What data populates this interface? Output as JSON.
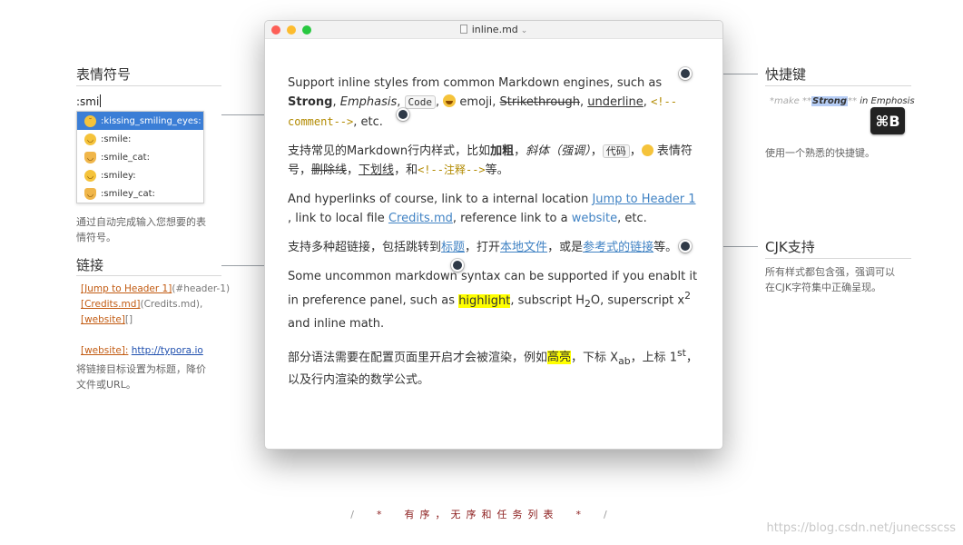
{
  "window": {
    "title": "inline.md"
  },
  "annotations": {
    "emoji": {
      "title": "表情符号",
      "typed": ":smi",
      "suggestions": [
        {
          "icon": "kissing-smiling-eyes-emoji",
          "label": ":kissing_smiling_eyes:"
        },
        {
          "icon": "smile-emoji",
          "label": ":smile:"
        },
        {
          "icon": "smile-cat-emoji",
          "label": ":smile_cat:"
        },
        {
          "icon": "smiley-emoji",
          "label": ":smiley:"
        },
        {
          "icon": "smiley-cat-emoji",
          "label": ":smiley_cat:"
        }
      ],
      "desc1": "通过自动完成输入您想要的表",
      "desc2": "情符号。"
    },
    "links": {
      "title": "链接",
      "line1_a": "[Jump to Header 1]",
      "line1_b": "(#header-1)",
      "line2_a": "[Credits.md]",
      "line2_b": "(Credits.md),",
      "line3_a": "[website]",
      "line3_b": "[]",
      "line4_a": "[website]:",
      "line4_b": "http://typora.io",
      "desc1": "将链接目标设置为标题，降价",
      "desc2": "文件或URL。"
    },
    "shortcut": {
      "title": "快捷键",
      "prefix": "*make",
      "stars1": "**",
      "strong": "Strong",
      "stars2": "**",
      "suffix": "in Emphosis",
      "key": "⌘B",
      "desc": "使用一个熟悉的快捷键。"
    },
    "cjk": {
      "title": "CJK支持",
      "desc1": "所有样式都包含强，强调可以",
      "desc2": "在CJK字符集中正确呈现。"
    }
  },
  "content": {
    "p1": {
      "t1": "Support inline styles from common Markdown engines, such as ",
      "strong": "Strong",
      "t2": ", ",
      "em": "Emphasis",
      "t3": ", ",
      "code": "Code",
      "t4": ", ",
      "t5": " emoji, ",
      "strike": "Strikethrough",
      "t6": ", ",
      "underline": "underline",
      "t7": ", ",
      "comment": "<!--comment-->",
      "t8": ", etc."
    },
    "p2": {
      "t1": "支持常见的Markdown行内样式，比如",
      "strong": "加粗",
      "t2": "，",
      "em": "斜体（强调）",
      "t3": "，",
      "code": "代码",
      "t4": "，",
      "t5": " 表情符号，",
      "strike": "删除线",
      "t6": "，",
      "underline": "下划线",
      "t7": "，和",
      "comment": "<!--注释-->",
      "t8": "等。"
    },
    "p3": {
      "t1": "And hyperlinks of course, link to a internal location ",
      "link1": "Jump to Header 1",
      "t2": " , link to local file ",
      "link2": "Credits.md",
      "t3": ", reference link to a ",
      "link3": "website",
      "t4": ", etc."
    },
    "p4": {
      "t1": "支持多种超链接，包括跳转到",
      "link1": "标题",
      "t2": "，打开",
      "link2": "本地文件",
      "t3": "，或是",
      "link3": "参考式的链接",
      "t4": "等。"
    },
    "p5": {
      "t1": "Some uncommon markdown syntax can be supported if you enablt it in preference panel, such as ",
      "highlight": "highlight",
      "t2": ", subscript H",
      "sub": "2",
      "t3": "O, superscript x",
      "sup": "2",
      "t4": " and inline math."
    },
    "p6": {
      "t1": "部分语法需要在配置页面里开启才会被渲染，例如",
      "highlight": "高亮",
      "t2": "，下标 X",
      "sub": "ab",
      "t3": "，上标 1",
      "sup": "st",
      "t4": "，以及行内渲染的数学公式。"
    }
  },
  "footer": {
    "slash1": "/",
    "star1": "*",
    "text": "有序，无序和任务列表",
    "star2": "*",
    "slash2": "/"
  },
  "watermark": "https://blog.csdn.net/junecsscss",
  "colors": {
    "link": "#4183c4",
    "highlight": "#ffff00",
    "selection": "#3b7ed6",
    "marker": "#2f3a48"
  }
}
